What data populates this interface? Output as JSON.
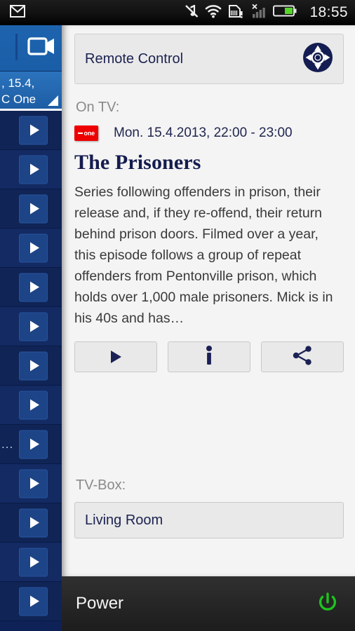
{
  "statusbar": {
    "clock": "18:55",
    "icons": {
      "app": "gmail-icon",
      "mute": "sound-muted-icon",
      "wifi": "wifi-icon",
      "sdcard": "sd-card-alert-icon",
      "signal": "no-signal-icon",
      "battery": "battery-icon"
    }
  },
  "sidebar": {
    "top_card": {
      "icon": "video-record-icon"
    },
    "selected_card": {
      "line1": ", 15.4,",
      "line2": "C One",
      "corner": "resize-corner-icon"
    },
    "rows": [
      {
        "label": "",
        "icon": "play-icon"
      },
      {
        "label": "",
        "icon": "play-icon"
      },
      {
        "label": "",
        "icon": "play-icon"
      },
      {
        "label": "",
        "icon": "play-icon"
      },
      {
        "label": "",
        "icon": "play-icon"
      },
      {
        "label": "",
        "icon": "play-icon"
      },
      {
        "label": "",
        "icon": "play-icon"
      },
      {
        "label": "",
        "icon": "play-icon"
      },
      {
        "label": "...",
        "icon": "play-icon"
      },
      {
        "label": "",
        "icon": "play-icon"
      },
      {
        "label": "",
        "icon": "play-icon"
      },
      {
        "label": "",
        "icon": "play-icon"
      },
      {
        "label": "",
        "icon": "play-icon"
      }
    ]
  },
  "main": {
    "remote_control": {
      "title": "Remote Control",
      "icon": "dpad-icon"
    },
    "on_tv_label": "On TV:",
    "channel": {
      "logo_text": "one",
      "name": "BBC One"
    },
    "schedule": "Mon. 15.4.2013, 22:00 - 23:00",
    "program_title": "The Prisoners",
    "program_description": "Series following offenders in prison, their release and, if they re-offend, their return behind prison doors. Filmed over a year, this episode follows a group of repeat offenders from Pentonville prison, which holds over 1,000 male prisoners. Mick is in his 40s and has…",
    "actions": [
      {
        "name": "play-button",
        "icon": "play-icon"
      },
      {
        "name": "info-button",
        "icon": "info-icon"
      },
      {
        "name": "share-button",
        "icon": "share-icon"
      }
    ],
    "tv_box_label": "TV-Box:",
    "tv_box_value": "Living Room"
  },
  "power": {
    "label": "Power",
    "icon": "power-icon"
  },
  "colors": {
    "accent_navy": "#1b2250",
    "sidebar_navy": "#0f2257",
    "sidebar_highlight": "#2b73bd",
    "panel_bg": "#f4f4f4",
    "card_bg": "#e9e9e9",
    "channel_red": "#ee0000",
    "power_green": "#1fc21f",
    "statusbar_bg": "#111111"
  }
}
